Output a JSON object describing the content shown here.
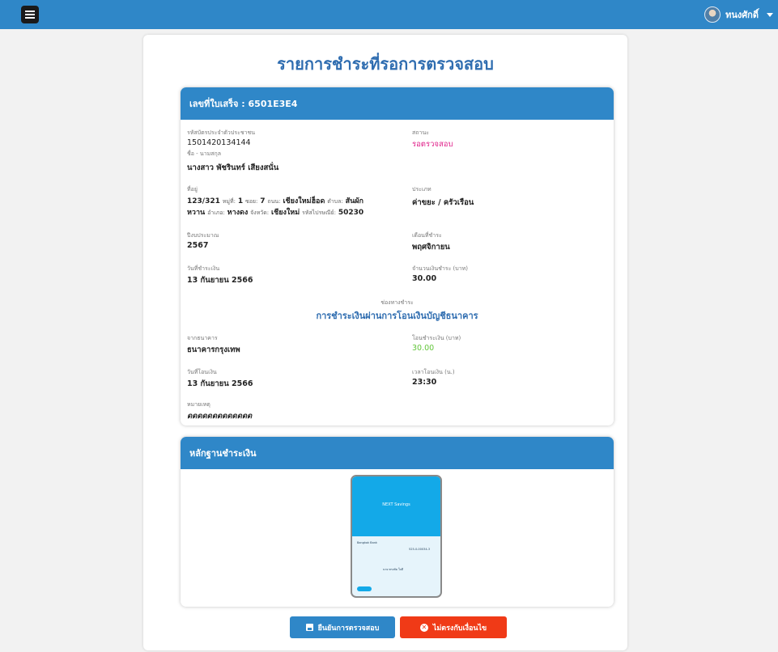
{
  "header": {
    "user_name": "ทนงศักดิ์"
  },
  "page": {
    "title": "รายการชำระที่รอการตรวจสอบ"
  },
  "receipt": {
    "header_label": "เลขที่ใบเสร็จ : 6501E3E4",
    "citizen_id_label": "รหัสบัตรประจำตัวประชาชน",
    "citizen_id": "1501420134144",
    "status_label": "สถานะ",
    "status": "รอตรวจสอบ",
    "name_label": "ชื่อ - นามสกุล",
    "name": "นางสาว พัชรินทร์ เสียงสนั่น",
    "address_label": "ที่อยู่",
    "address": {
      "house_no": "123/321",
      "moo_label": "หมู่ที่:",
      "moo": "1",
      "soi_label": "ซอย:",
      "soi": "7",
      "road_label": "ถนน:",
      "road": "เชียงใหม่ฮ็อด",
      "subdistrict_label": "ตำบล:",
      "subdistrict_1": "สันผัก",
      "subdistrict_2": "หวาน",
      "district_label": "อำเภอ:",
      "district": "หางดง",
      "province_label": "จังหวัด:",
      "province": "เชียงใหม่",
      "postcode_label": "รหัสไปรษณีย์:",
      "postcode": "50230"
    },
    "type_label": "ประเภท",
    "type": "ค่าขยะ / ครัวเรือน",
    "budget_year_label": "ปีงบประมาณ",
    "budget_year": "2567",
    "month_label": "เดือนที่ชำระ",
    "month": "พฤศจิกายน",
    "pay_date_label": "วันที่ชำระเงิน",
    "pay_date": "13 กันยายน 2566",
    "amount_label": "จำนวนเงินชำระ (บาท)",
    "amount": "30.00",
    "channel_label": "ช่องทางชำระ",
    "channel": "การชำระเงินผ่านการโอนเงินบัญชีธนาคาร",
    "bank_label": "จากธนาคาร",
    "bank": "ธนาคารกรุงเทพ",
    "transfer_amount_label": "โอนชำระเงิน (บาท)",
    "transfer_amount": "30.00",
    "transfer_date_label": "วันที่โอนเงิน",
    "transfer_date": "13 กันยายน 2566",
    "transfer_time_label": "เวลาโอนเงิน (น.)",
    "transfer_time": "23:30",
    "note_label": "หมายเหตุ",
    "note": "ดดดดดดดดดดดดด"
  },
  "evidence": {
    "header_label": "หลักฐานชำระเงิน",
    "slip_title": "NEXT Savings",
    "slip_from_label": "Bangkok Bank",
    "slip_account": "525-0-00034-3",
    "slip_to": "นาย ทรงชัย ใจดี"
  },
  "actions": {
    "confirm_label": "ยืนยันการตรวจสอบ",
    "reject_label": "ไม่ตรงกับเงื่อนไข"
  },
  "colors": {
    "primary": "#2f87c8",
    "danger": "#f03a17",
    "status_pink": "#e0218a",
    "amount_green": "#63c63b"
  }
}
